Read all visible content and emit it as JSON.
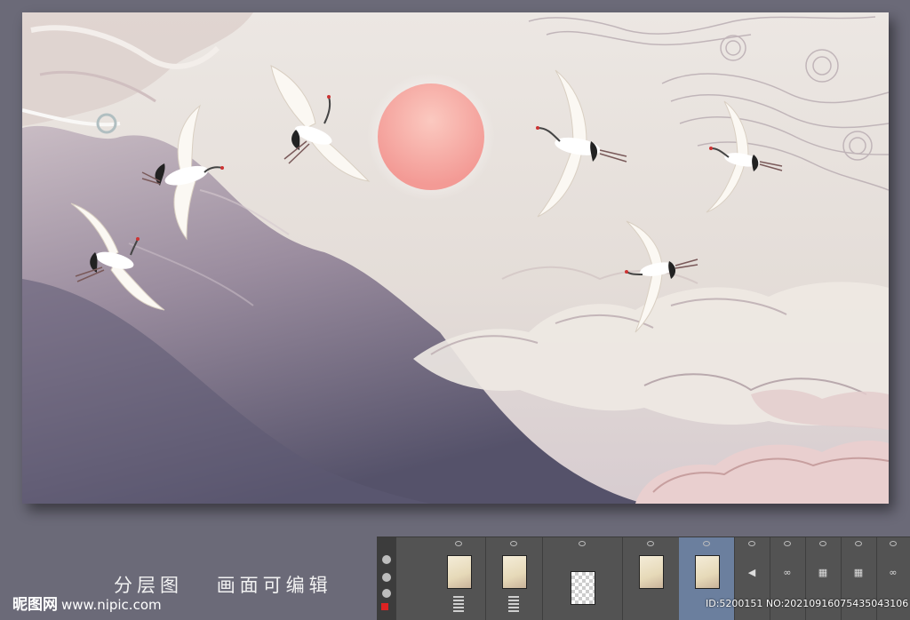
{
  "caption": {
    "layered": "分层图",
    "editable": "画面可编辑"
  },
  "watermark": {
    "brand": "昵图网",
    "url": "www.nipic.com"
  },
  "image_id": "ID:5200151 NO:20210916075435043106",
  "artwork": {
    "sun_color": "#f6a9a3",
    "sky_color": "#ebe6e2",
    "mountain_color": "#8d7f91",
    "cloud_line_color": "#bdb0b8",
    "icons": [
      "crane-bird",
      "sun",
      "auspicious-cloud",
      "mountain"
    ]
  },
  "layers_panel": {
    "accent_selected": "#6b7f9e",
    "columns": [
      "thumb",
      "thumb",
      "checker",
      "thumb",
      "thumb-selected",
      "glyph",
      "glyph",
      "glyph",
      "glyph",
      "glyph"
    ]
  }
}
